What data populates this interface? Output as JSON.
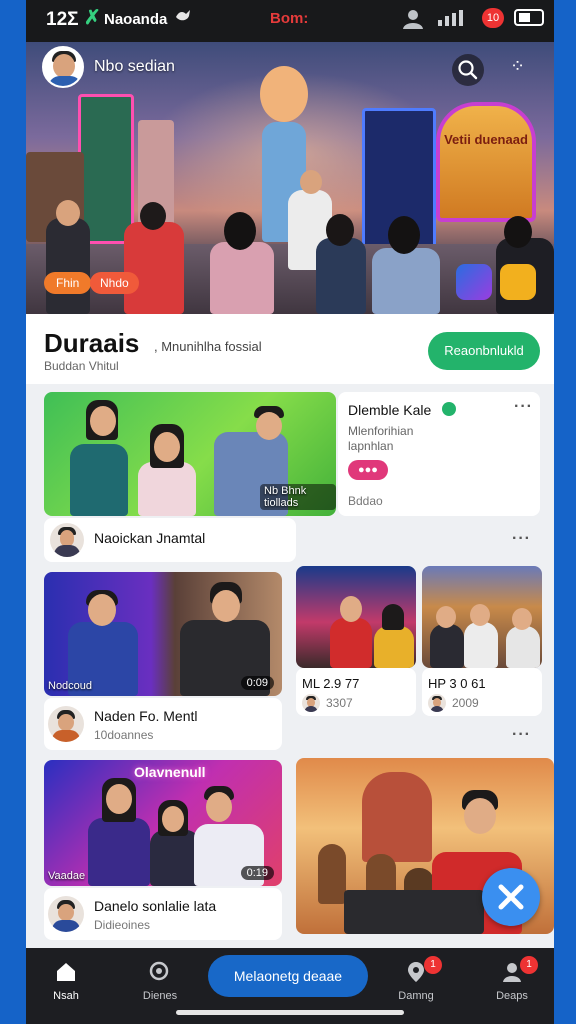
{
  "status_bar": {
    "time": "12Σ",
    "carrier": "Naoanda",
    "center": "Bom:",
    "notifications": "10"
  },
  "hero": {
    "host_name": "Nbo sedian",
    "pill_a": "Fhin",
    "pill_b": "Nhdo",
    "sign_text": "Vetii duenaad"
  },
  "title": {
    "heading": "Duraais",
    "subtitle": ", Mnunihlha fossial",
    "meta": "Buddan Vhitul",
    "cta": "Reaonbnlukld"
  },
  "featured": {
    "thumb_tag": "Nb Bhnk tiollads",
    "side_title": "Dlemble Kale",
    "side_desc": "Mlenforihian lapnhlan",
    "side_stat": "Bddao",
    "side_pill": "●●●"
  },
  "row1": {
    "author": "Naoickan Jnamtal"
  },
  "card_a": {
    "tag": "Nodcoud",
    "duration": "0:09",
    "title": "Naden Fo. Mentl",
    "sub": "10doannes"
  },
  "card_b": {
    "title": "ML 2.9 77",
    "stat": "3307"
  },
  "card_c": {
    "title": "HP 3 0 61",
    "stat": "2009"
  },
  "card_d": {
    "banner": "Olavnenull",
    "tag": "Vaadae",
    "duration": "0:19",
    "title": "Danelo sonlalie lata",
    "sub": "Didieoines"
  },
  "bottom_nav": {
    "home": "Nsah",
    "discover": "Dienes",
    "main": "Melaonetg deaae",
    "gaming": "Damng",
    "groups": "Deaps",
    "gaming_badge": "1",
    "groups_badge": "1"
  },
  "colors": {
    "accent_green": "#23b36b",
    "accent_blue": "#1868c8",
    "badge_red": "#e33333"
  }
}
